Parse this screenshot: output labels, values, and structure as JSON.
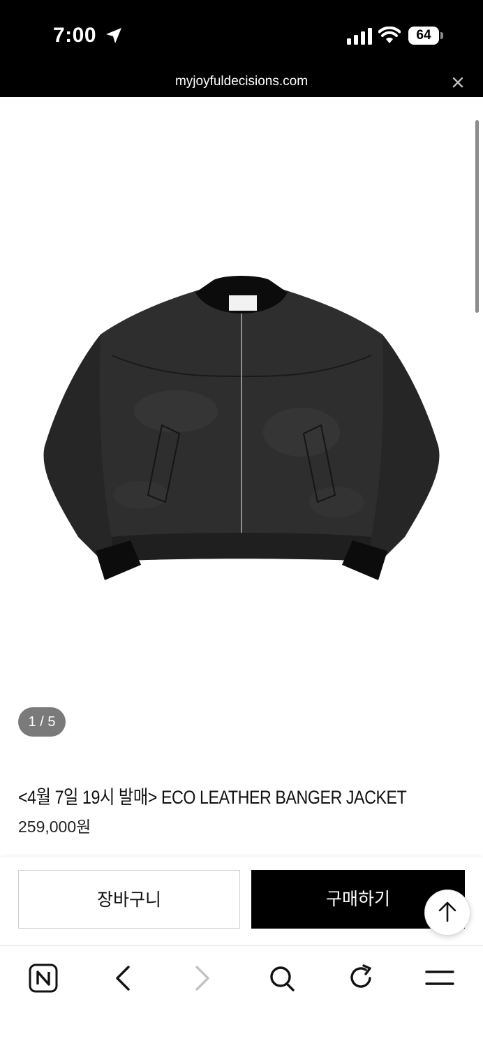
{
  "status_bar": {
    "time": "7:00",
    "battery": "64"
  },
  "browser": {
    "url": "myjoyfuldecisions.com"
  },
  "product": {
    "image_alt": "ECO LEATHER BANGER JACKET",
    "image_counter": "1 / 5",
    "title": "<4월 7일 19시 발매> ECO LEATHER BANGER JACKET",
    "price": "259,000원"
  },
  "actions": {
    "cart_label": "장바구니",
    "buy_label": "구매하기"
  },
  "colors": {
    "primary_button": "#000000",
    "page_background": "#ffffff",
    "counter_pill": "#7a7a7a"
  },
  "icons": {
    "nav": [
      "naver-home-icon",
      "back-icon",
      "forward-icon",
      "search-icon",
      "refresh-icon",
      "menu-icon"
    ]
  }
}
